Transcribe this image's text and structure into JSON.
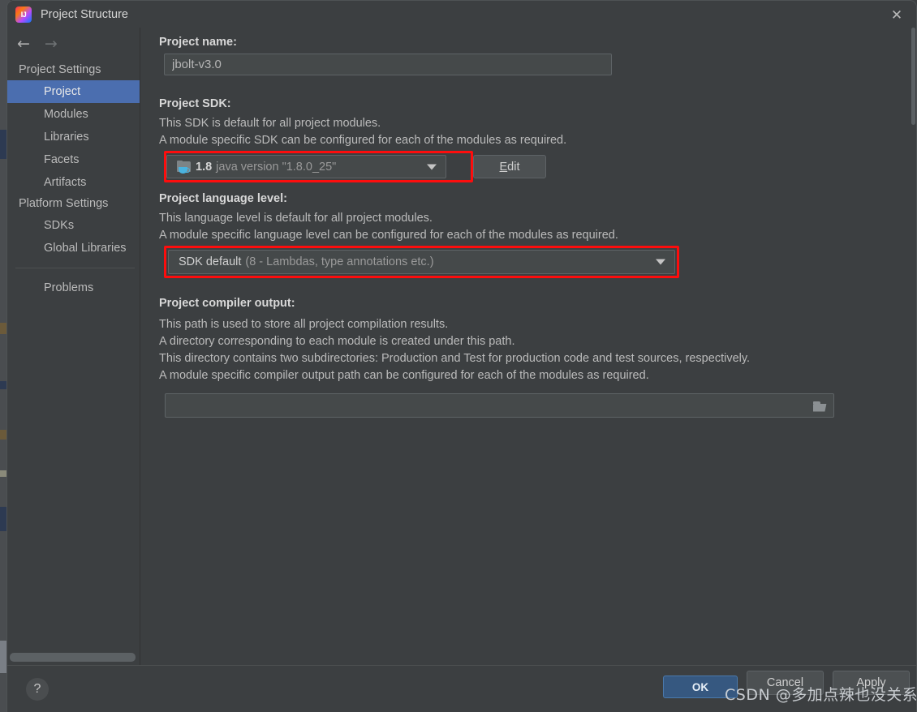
{
  "window": {
    "title": "Project Structure",
    "app_icon": "intellij-idea-icon",
    "close_icon": "close-icon"
  },
  "nav": {
    "back_icon": "arrow-left-icon",
    "forward_icon": "arrow-right-icon"
  },
  "sidebar": {
    "groups": [
      {
        "title": "Project Settings",
        "items": [
          {
            "label": "Project",
            "selected": true
          },
          {
            "label": "Modules",
            "selected": false
          },
          {
            "label": "Libraries",
            "selected": false
          },
          {
            "label": "Facets",
            "selected": false
          },
          {
            "label": "Artifacts",
            "selected": false
          }
        ]
      },
      {
        "title": "Platform Settings",
        "items": [
          {
            "label": "SDKs",
            "selected": false
          },
          {
            "label": "Global Libraries",
            "selected": false
          }
        ]
      }
    ],
    "extra_items": [
      {
        "label": "Problems",
        "selected": false
      }
    ]
  },
  "main": {
    "project_name": {
      "label": "Project name:",
      "value": "jbolt-v3.0"
    },
    "project_sdk": {
      "label": "Project SDK:",
      "descriptions": [
        "This SDK is default for all project modules.",
        "A module specific SDK can be configured for each of the modules as required."
      ],
      "icon": "java-sdk-folder-icon",
      "selected_version": "1.8",
      "selected_detail": "java version \"1.8.0_25\"",
      "edit_button": {
        "mnemonic": "E",
        "rest": "dit"
      }
    },
    "language_level": {
      "label": "Project language level:",
      "descriptions": [
        "This language level is default for all project modules.",
        "A module specific language level can be configured for each of the modules as required."
      ],
      "selected_main": "SDK default",
      "selected_detail": "(8 - Lambdas, type annotations etc.)"
    },
    "compiler_output": {
      "label": "Project compiler output:",
      "descriptions": [
        "This path is used to store all project compilation results.",
        "A directory corresponding to each module is created under this path.",
        "This directory contains two subdirectories: Production and Test for production code and test sources, respectively.",
        "A module specific compiler output path can be configured for each of the modules as required."
      ],
      "value": "",
      "browse_icon": "folder-open-icon"
    }
  },
  "footer": {
    "help_label": "?",
    "ok_label": "OK",
    "cancel_label": "Cancel",
    "apply_label": "Apply"
  },
  "watermark": {
    "text": "CSDN @多加点辣也没关系"
  },
  "colors": {
    "dialog_bg": "#3c3f41",
    "field_bg": "#45494a",
    "selection_blue": "#4b6eaf",
    "primary_button": "#365880",
    "annotation_red": "#fd0d0d"
  }
}
